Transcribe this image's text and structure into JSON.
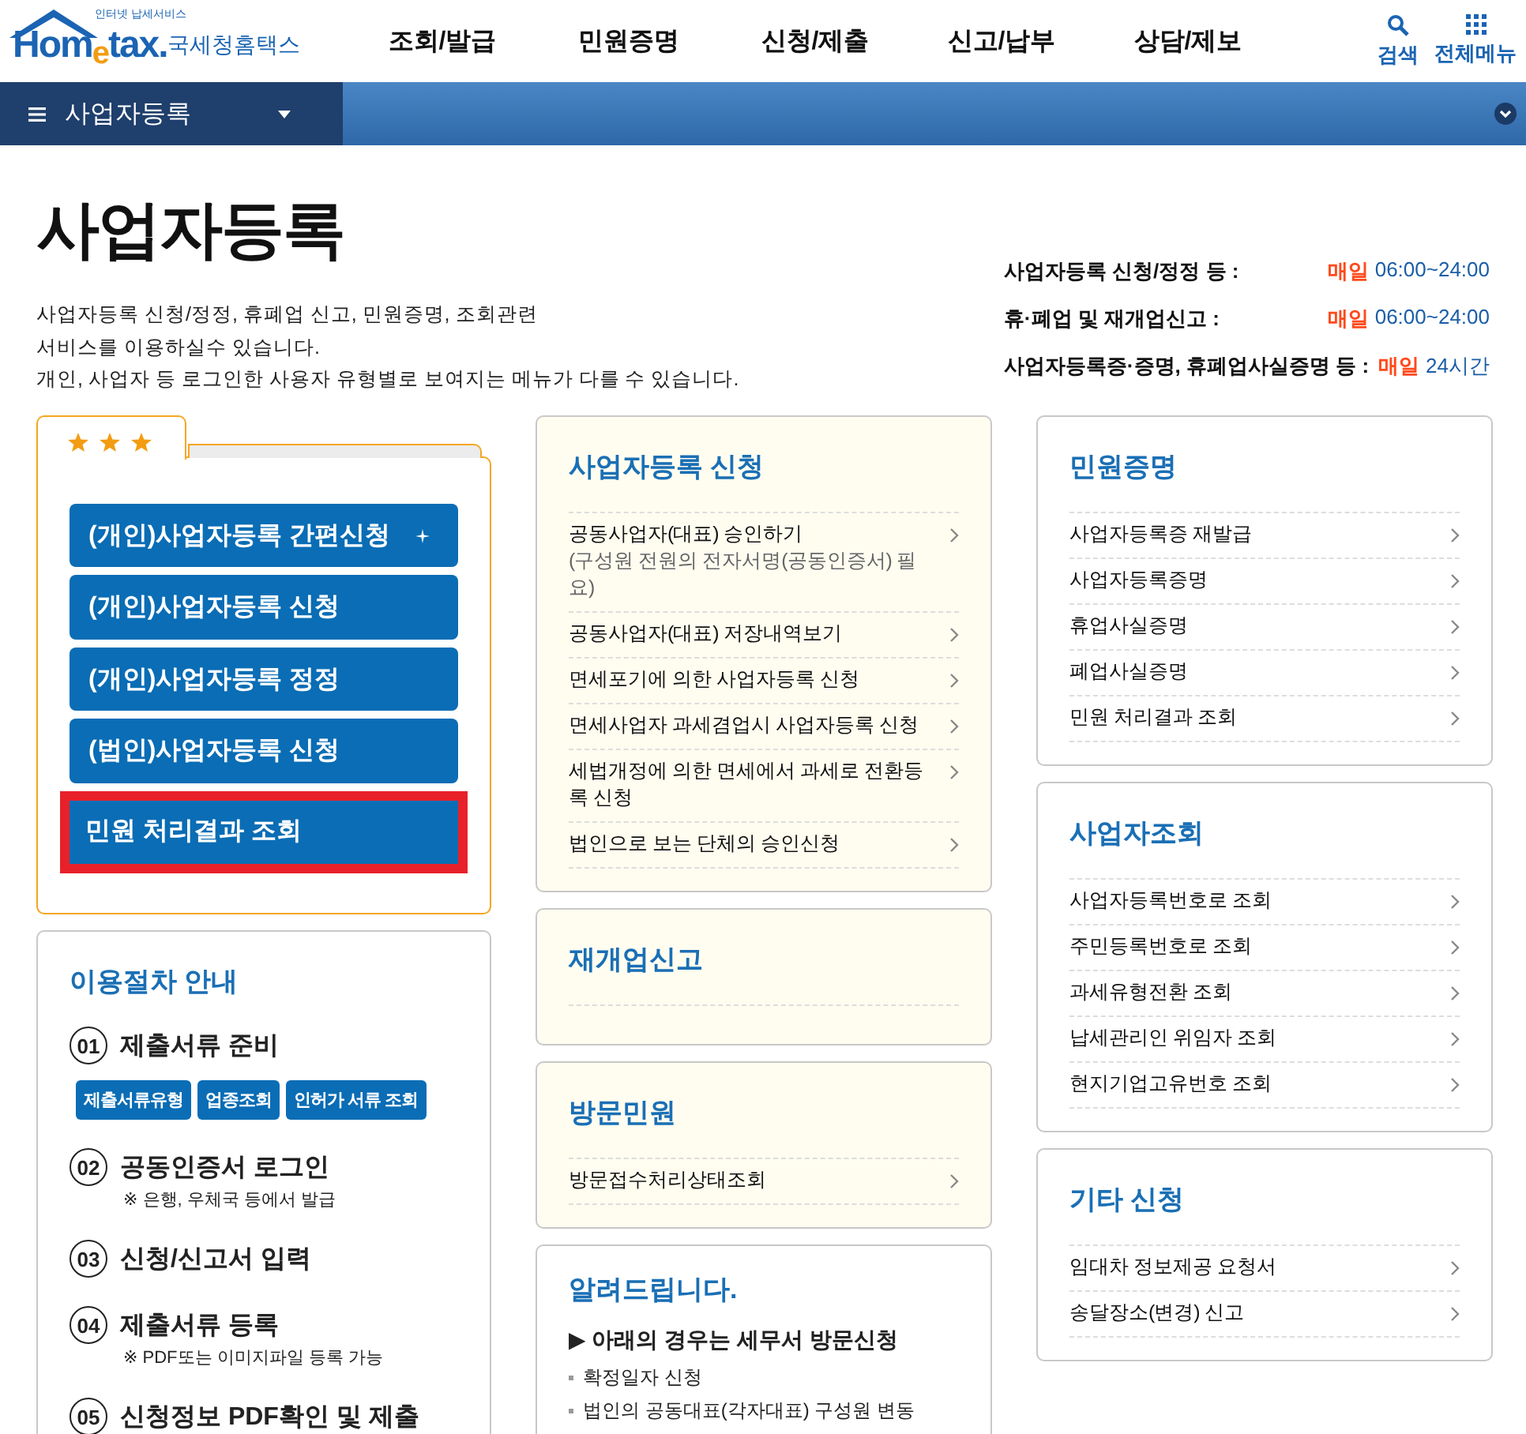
{
  "header": {
    "logo_tagline": "인터넷 납세서비스",
    "logo_brand": "Hom$_{e}$tax.",
    "logo_name": "국세청홈택스",
    "nav": [
      "조회/발급",
      "민원증명",
      "신청/제출",
      "신고/납부",
      "상담/제보"
    ],
    "utilities": [
      {
        "kind": "search",
        "label": "검색"
      },
      {
        "kind": "grid",
        "label": "전체메뉴"
      }
    ]
  },
  "breadcrumb": {
    "label": "사업자등록"
  },
  "page": {
    "title": "사업자등록",
    "description": [
      "사업자등록 신청/정정, 휴폐업 신고, 민원증명, 조회관련",
      "서비스를 이용하실수 있습니다.",
      "개인, 사업자 등 로그인한 사용자 유형별로 보여지는 메뉴가 다를 수 있습니다."
    ],
    "hours": [
      {
        "label": "사업자등록 신청/정정 등 :",
        "day": "매일",
        "time": "06:00~24:00"
      },
      {
        "label": "휴·폐업 및 재개업신고 :",
        "day": "매일",
        "time": "06:00~24:00"
      },
      {
        "label": "사업자등록증·증명, 휴폐업사실증명 등 :",
        "day": "매일",
        "time": "24시간"
      }
    ]
  },
  "favorites": {
    "buttons": [
      {
        "label": "(개인)사업자등록 간편신청",
        "kind": "quick",
        "highlighted": false
      },
      {
        "label": "(개인)사업자등록 신청",
        "kind": "plain",
        "highlighted": false
      },
      {
        "label": "(개인)사업자등록 정정",
        "kind": "plain",
        "highlighted": false
      },
      {
        "label": "(법인)사업자등록 신청",
        "kind": "plain",
        "highlighted": false
      },
      {
        "label": "민원 처리결과 조회",
        "kind": "plain",
        "highlighted": true
      }
    ]
  },
  "procedure": {
    "title": "이용절차 안내",
    "steps": [
      {
        "number": "01",
        "title": "제출서류 준비",
        "buttons": [
          "제출서류유형",
          "업종조회",
          "인허가 서류 조회"
        ]
      },
      {
        "number": "02",
        "title": "공동인증서 로그인",
        "note": "※ 은행, 우체국 등에서 발급"
      },
      {
        "number": "03",
        "title": "신청/신고서 입력"
      },
      {
        "number": "04",
        "title": "제출서류 등록",
        "note": "※ PDF또는 이미지파일 등록 가능"
      },
      {
        "number": "05",
        "title": "신청정보 PDF확인 및 제출"
      }
    ]
  },
  "middle_cards": [
    {
      "title": "사업자등록 신청",
      "links": [
        {
          "label": "공동사업자(대표) 승인하기",
          "sub": "(구성원 전원의 전자서명(공동인증서) 필요)"
        },
        {
          "label": "공동사업자(대표) 저장내역보기"
        },
        {
          "label": "면세포기에 의한 사업자등록 신청"
        },
        {
          "label": "면세사업자 과세겸업시 사업자등록 신청"
        },
        {
          "label": "세법개정에 의한 면세에서 과세로 전환등록 신청"
        },
        {
          "label": "법인으로 보는 단체의 승인신청"
        }
      ]
    },
    {
      "title": "재개업신고"
    },
    {
      "title": "방문민원",
      "links": [
        {
          "label": "방문접수처리상태조회"
        }
      ]
    }
  ],
  "notice": {
    "title": "알려드립니다.",
    "heading": "▶ 아래의 경우는 세무서 방문신청",
    "items": [
      "확정일자 신청",
      "법인의 공동대표(각자대표) 구성원 변동"
    ]
  },
  "right_cards": [
    {
      "title": "민원증명",
      "links": [
        {
          "label": "사업자등록증 재발급"
        },
        {
          "label": "사업자등록증명"
        },
        {
          "label": "휴업사실증명"
        },
        {
          "label": "폐업사실증명"
        },
        {
          "label": "민원 처리결과 조회"
        }
      ]
    },
    {
      "title": "사업자조회",
      "links": [
        {
          "label": "사업자등록번호로 조회"
        },
        {
          "label": "주민등록번호로 조회"
        },
        {
          "label": "과세유형전환 조회"
        },
        {
          "label": "납세관리인 위임자 조회"
        },
        {
          "label": "현지기업고유번호 조회"
        }
      ]
    },
    {
      "title": "기타 신청",
      "links": [
        {
          "label": "임대차 정보제공 요청서"
        },
        {
          "label": "송달장소(변경) 신고"
        }
      ]
    }
  ]
}
